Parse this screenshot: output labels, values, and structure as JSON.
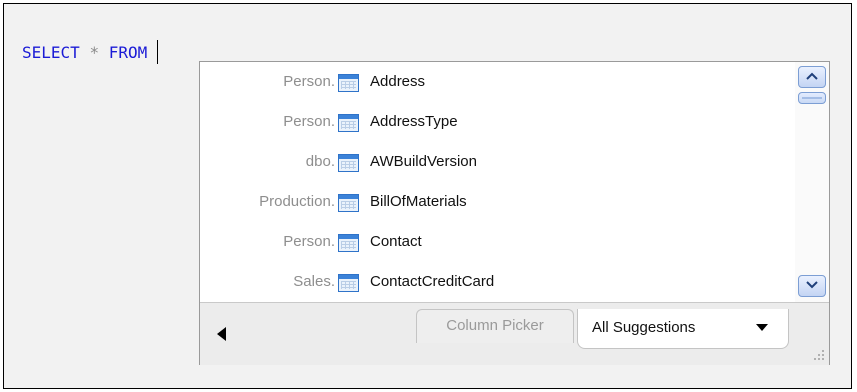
{
  "editor": {
    "sql_keyword_select": "SELECT",
    "sql_star": "*",
    "sql_keyword_from": "FROM"
  },
  "suggestions": {
    "items": [
      {
        "schema": "Person.",
        "name": "Address",
        "icon": "table-icon"
      },
      {
        "schema": "Person.",
        "name": "AddressType",
        "icon": "table-icon"
      },
      {
        "schema": "dbo.",
        "name": "AWBuildVersion",
        "icon": "table-icon"
      },
      {
        "schema": "Production.",
        "name": "BillOfMaterials",
        "icon": "table-icon"
      },
      {
        "schema": "Person.",
        "name": "Contact",
        "icon": "table-icon"
      },
      {
        "schema": "Sales.",
        "name": "ContactCreditCard",
        "icon": "table-icon"
      }
    ]
  },
  "tabs": {
    "column_picker": "Column Picker",
    "all_suggestions": "All Suggestions"
  },
  "colors": {
    "keyword": "#1b1bd6",
    "schema_text": "#8e8e8e",
    "table_icon": "#3b82d8",
    "scrollbar_accent": "#7c9ed4"
  }
}
